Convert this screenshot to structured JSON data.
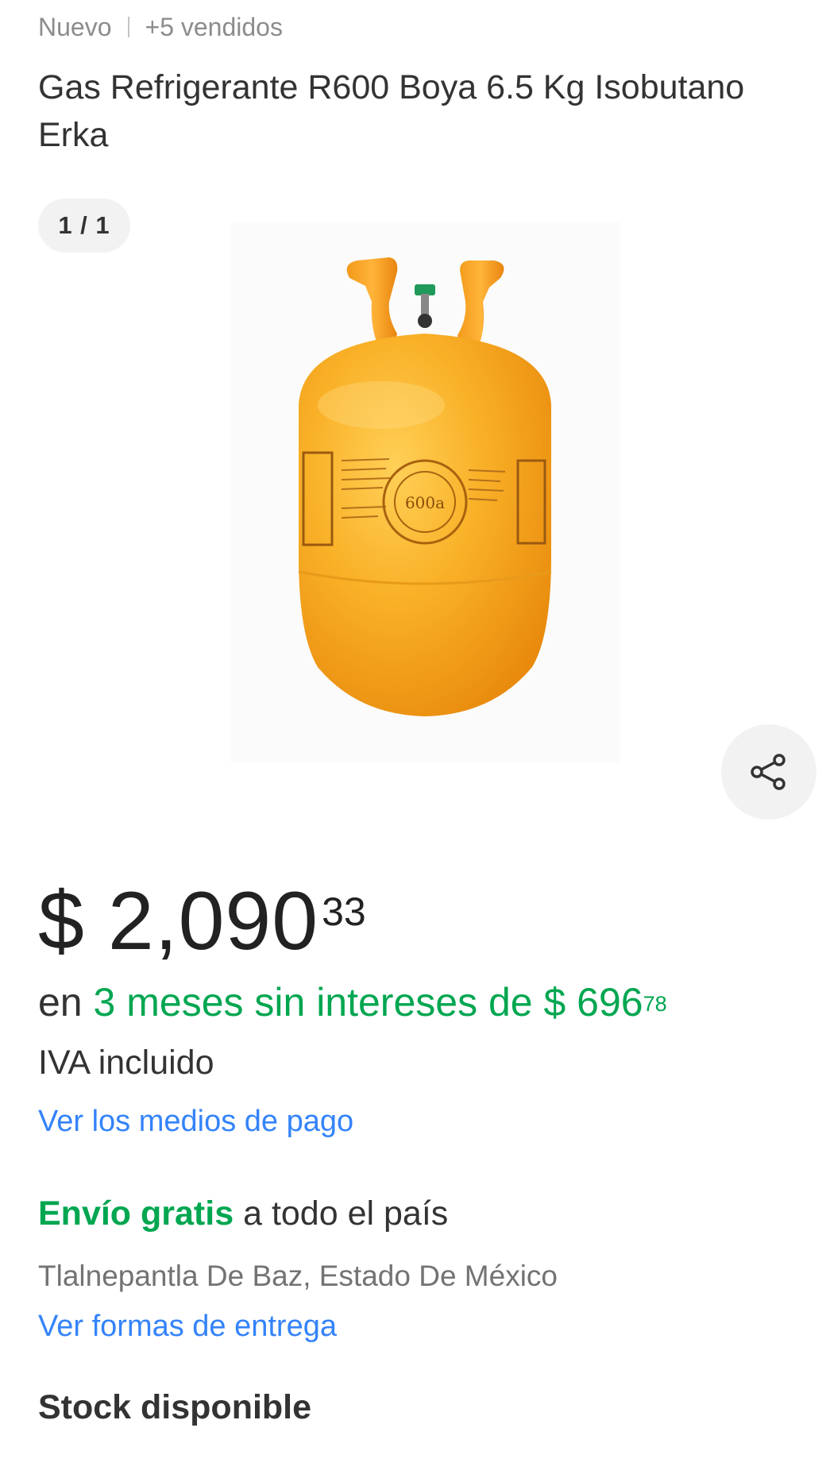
{
  "header": {
    "condition": "Nuevo",
    "sold_count": "+5 vendidos"
  },
  "product": {
    "title": "Gas Refrigerante R600 Boya 6.5 Kg Isobutano Erka",
    "image_icon": "orange-refrigerant-tank-image",
    "cylinder_label": "600a"
  },
  "gallery": {
    "counter": "1 / 1",
    "share_icon": "share-icon"
  },
  "price": {
    "currency": "$",
    "amount": "2,090",
    "cents": "33"
  },
  "installments": {
    "prefix": "en",
    "text": "3 meses sin intereses de $ 696",
    "cents": "78"
  },
  "tax_note": "IVA incluido",
  "payment_link": "Ver los medios de pago",
  "shipping": {
    "free_label": "Envío gratis",
    "rest": "a todo el país",
    "location": "Tlalnepantla De Baz, Estado De México",
    "delivery_link": "Ver formas de entrega"
  },
  "stock": "Stock disponible",
  "colors": {
    "green": "#00a650",
    "link_blue": "#3483fa",
    "text": "#333333",
    "muted": "#8c8c8c",
    "tank_orange": "#f5a21b"
  }
}
